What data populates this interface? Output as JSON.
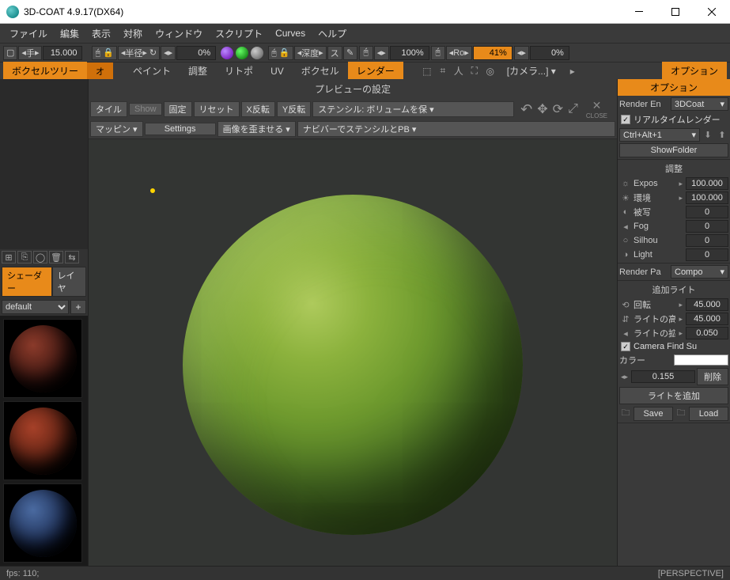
{
  "window": {
    "title": "3D-COAT 4.9.17(DX64)"
  },
  "menu": [
    "ファイル",
    "編集",
    "表示",
    "対称",
    "ウィンドウ",
    "スクリプト",
    "Curves",
    "ヘルプ"
  ],
  "toolbar1": {
    "hand": "手",
    "hand_val": "15.000",
    "radius": "半径",
    "radius_val": "0%",
    "depth": "深度",
    "depth_lbl2": "ス",
    "pct100": "100%",
    "ro": "Ro",
    "ro_val": "41%",
    "last_val": "0%"
  },
  "tabs": {
    "left_active": "ボクセルツリー",
    "left_sub": "オ",
    "items": [
      "ペイント",
      "調整",
      "リトポ",
      "UV",
      "ボクセル"
    ],
    "render": "レンダー",
    "camera": "[カメラ...]",
    "options": "オプション"
  },
  "subtool": {
    "title": "プレビューの設定",
    "row2": [
      "タイル",
      "Show",
      "固定",
      "リセット",
      "X反転",
      "Y反転"
    ],
    "stencil": "ステンシル: ボリュームを保",
    "row3_a": "マッピン",
    "row3_b": "Settings",
    "row3_c": "画像を歪ませる",
    "row3_d": "ナビバーでステンシルとPB",
    "close": "CLOSE"
  },
  "left": {
    "tabs": [
      "シェーダー",
      "レイヤ"
    ],
    "select": "default"
  },
  "right": {
    "render_en": "Render En",
    "engine": "3DCoat",
    "realtime": "リアルタイムレンダー",
    "shortcut": "Ctrl+Alt+1",
    "showfolder": "ShowFolder",
    "adjust_title": "調整",
    "rows": [
      {
        "lbl": "Expos",
        "val": "100.000"
      },
      {
        "lbl": "環境",
        "val": "100.000"
      },
      {
        "lbl": "被写",
        "val": "0"
      },
      {
        "lbl": "Fog",
        "val": "0"
      },
      {
        "lbl": "Silhou",
        "val": "0"
      },
      {
        "lbl": "Light",
        "val": "0"
      }
    ],
    "render_pa": "Render Pa",
    "compo": "Compo",
    "addlight_title": "追加ライト",
    "rot": "回転",
    "rot_val": "45.000",
    "height": "ライトの高",
    "height_val": "45.000",
    "spread": "ライトの拡",
    "spread_val": "0.050",
    "camera_find": "Camera Find Su",
    "color_lbl": "カラー",
    "val155": "0.155",
    "delete": "削除",
    "add_light": "ライトを追加",
    "save": "Save",
    "load": "Load"
  },
  "status": {
    "fps": "fps: 110;",
    "mode": "[PERSPECTIVE]"
  }
}
